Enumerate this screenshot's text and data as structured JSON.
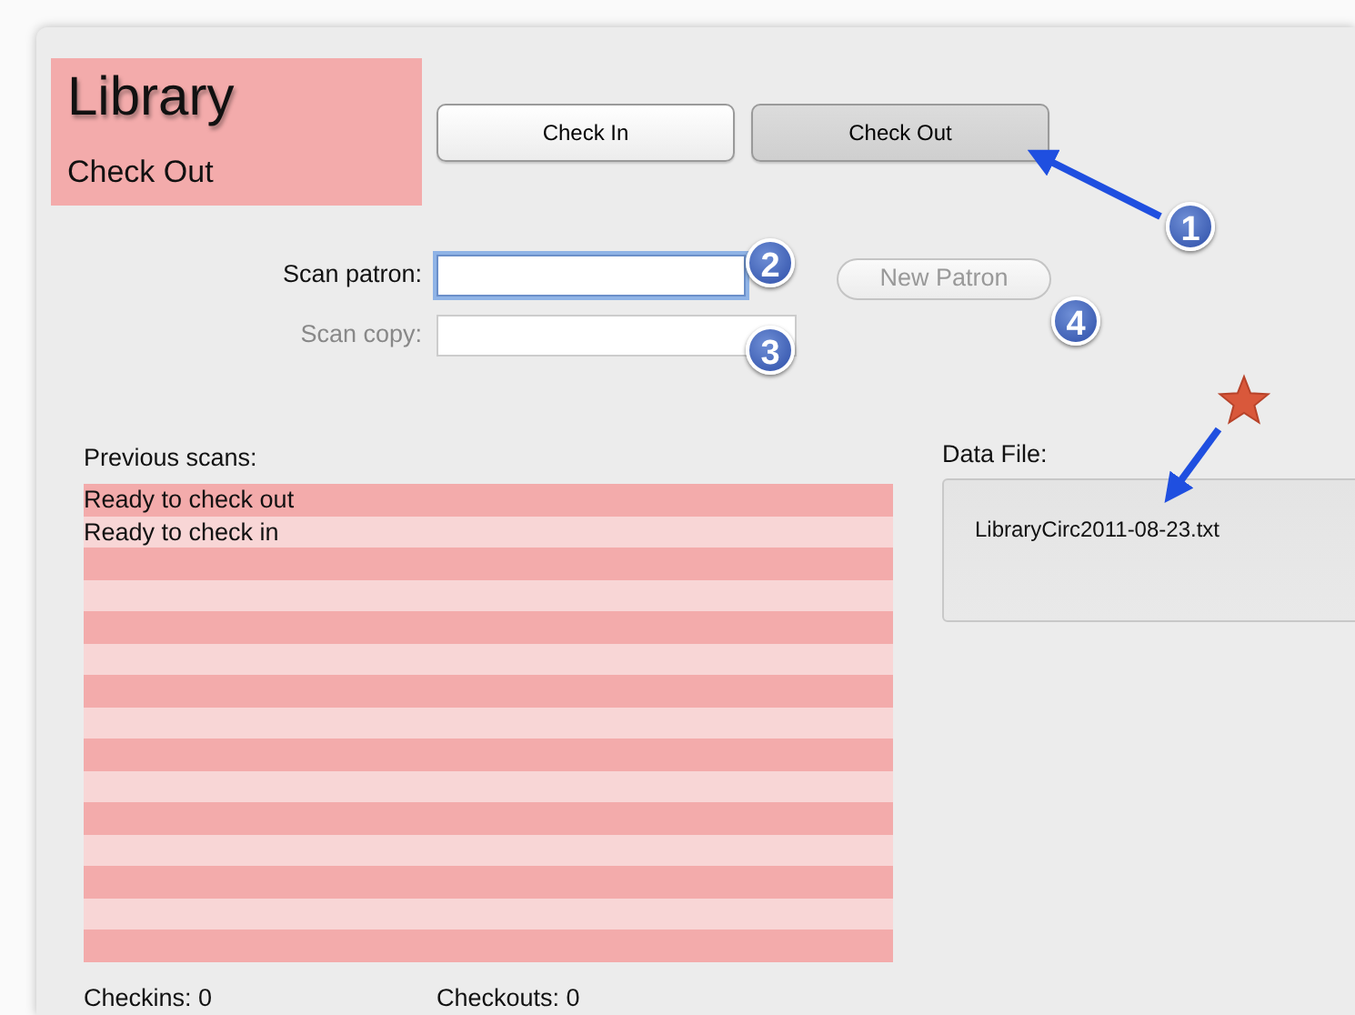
{
  "header": {
    "title": "Library",
    "subtitle": "Check Out"
  },
  "mode_buttons": [
    {
      "label": "Check In",
      "selected": false
    },
    {
      "label": "Check Out",
      "selected": true
    }
  ],
  "fields": [
    {
      "label": "Scan patron:",
      "focused": true,
      "disabled": false
    },
    {
      "label": "Scan copy:",
      "focused": false,
      "disabled": true
    }
  ],
  "new_patron_button": {
    "label": "New Patron",
    "disabled": true
  },
  "previous_scans": {
    "label": "Previous scans:",
    "rows": [
      "Ready to check out",
      "Ready to check in"
    ]
  },
  "data_file": {
    "label": "Data File:",
    "filename": "LibraryCirc2011-08-23.txt"
  },
  "counts": [
    "Checkins: 0",
    "Checkouts: 0"
  ],
  "callouts": [
    {
      "kind": "number",
      "text": "1"
    },
    {
      "kind": "number",
      "text": "2"
    },
    {
      "kind": "number",
      "text": "3"
    },
    {
      "kind": "number",
      "text": "4"
    },
    {
      "kind": "star"
    }
  ]
}
